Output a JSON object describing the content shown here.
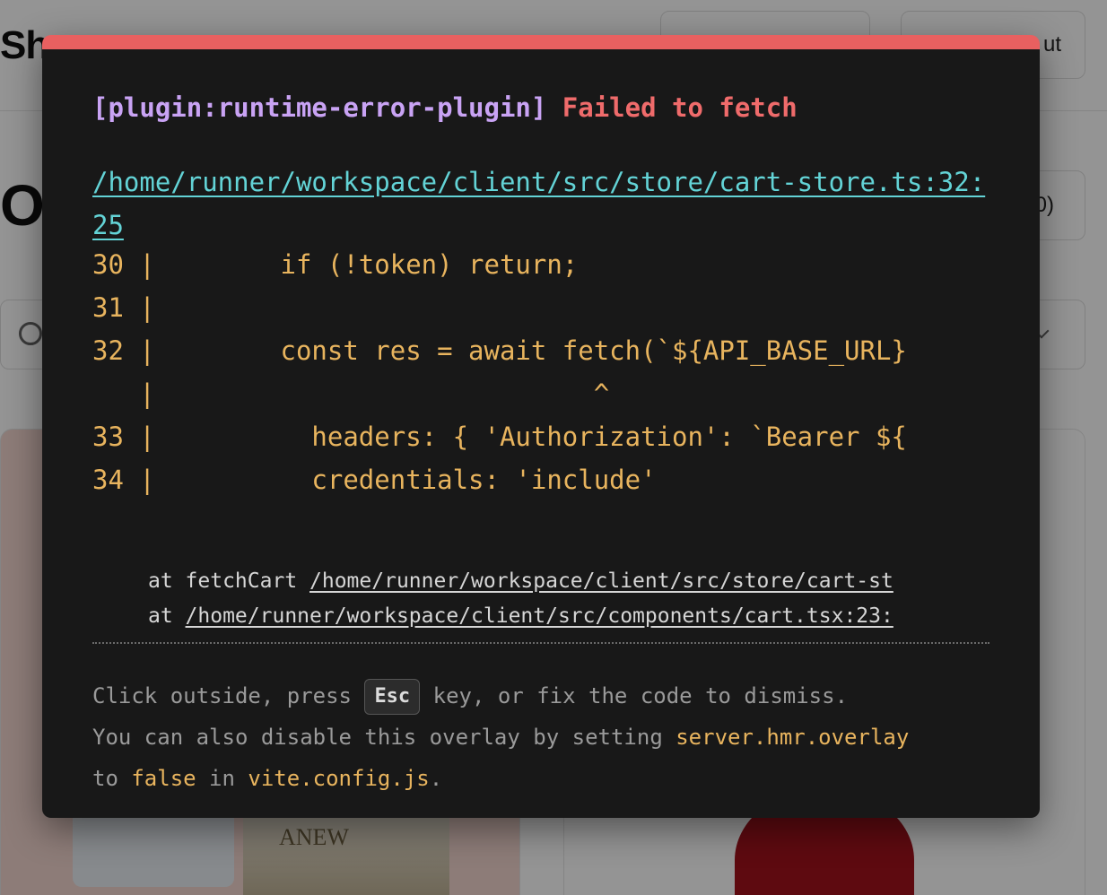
{
  "background": {
    "brand": "Sh",
    "header_button_1": "",
    "header_button_2": "ut",
    "page_title": "O",
    "cart_button": "0)",
    "product_1_text": "ANEW"
  },
  "overlay": {
    "plugin": "[plugin:runtime-error-plugin]",
    "message": "Failed to fetch",
    "file": "/home/runner/workspace/client/src/store/cart-store.ts:32:25",
    "frame": [
      "30 |        if (!token) return;",
      "31 |",
      "32 |        const res = await fetch(`${API_BASE_URL}",
      "   |                            ^",
      "33 |          headers: { 'Authorization': `Bearer ${",
      "34 |          credentials: 'include'"
    ],
    "stack": [
      {
        "prefix": "at fetchCart ",
        "file": "/home/runner/workspace/client/src/store/cart-st"
      },
      {
        "prefix": "at ",
        "file": "/home/runner/workspace/client/src/components/cart.tsx:23:"
      }
    ],
    "tip": {
      "line1_pre": "Click outside, press ",
      "key": "Esc",
      "line1_post": " key, or fix the code to dismiss.",
      "line2_pre": "You can also disable this overlay by setting ",
      "setting": "server.hmr.overlay",
      "line3_pre": "to ",
      "value": "false",
      "line3_mid": " in ",
      "config_file": "vite.config.js",
      "line3_end": "."
    },
    "colors": {
      "accent": "#e86060",
      "plugin": "#c9a3f4",
      "message": "#ef6b6b",
      "link": "#63d3d6",
      "code": "#e8b45e",
      "background": "#181818"
    }
  }
}
